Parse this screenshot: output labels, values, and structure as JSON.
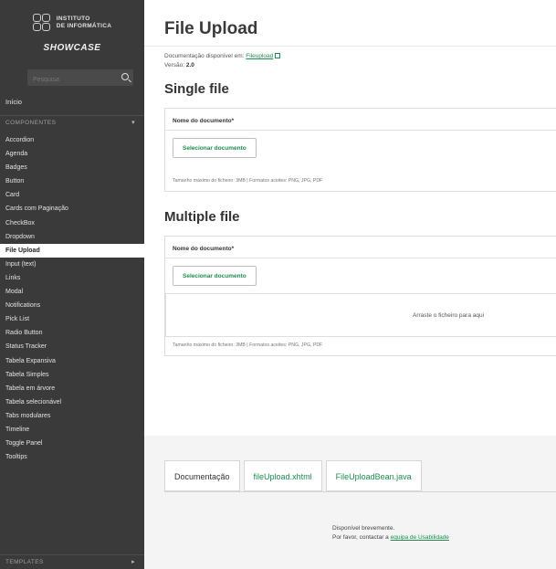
{
  "sidebar": {
    "logo_line1": "INSTITUTO",
    "logo_line2": "DE INFORMÁTICA",
    "showcase": "SHOWCASE",
    "search_placeholder": "Pesquisa",
    "inicio": "Início",
    "components_header": "COMPONENTES",
    "items": [
      "Accordion",
      "Agenda",
      "Badges",
      "Button",
      "Card",
      "Cards com Paginação",
      "CheckBox",
      "Dropdown",
      "File Upload",
      "Input (text)",
      "Links",
      "Modal",
      "Notifications",
      "Pick List",
      "Radio Button",
      "Status Tracker",
      "Tabela Expansiva",
      "Tabela Simples",
      "Tabela em árvore",
      "Tabela selecionável",
      "Tabs modulares",
      "Timeline",
      "Toggle Panel",
      "Tooltips"
    ],
    "active_index": 8,
    "templates_header": "TEMPLATES"
  },
  "main": {
    "title": "File Upload",
    "doc_prefix": "Documentação disponível em: ",
    "doc_link": "Fileupload",
    "version_label": "Versão: ",
    "version_value": "2.0",
    "single": {
      "heading": "Single file",
      "field_label": "Nome do documento*",
      "button": "Selecionar documento",
      "hint": "Tamanho máximo do ficheiro: 3MB | Formatos aceites: PNG, JPG, PDF"
    },
    "multiple": {
      "heading": "Multiple file",
      "field_label": "Nome do documento*",
      "button": "Selecionar documento",
      "drop_text": "Arraste o ficheiro para aqui",
      "hint": "Tamanho máximo do ficheiro: 3MB | Formatos aceites: PNG, JPG, PDF"
    },
    "tabs": [
      "Documentação",
      "fileUpload.xhtml",
      "FileUploadBean.java"
    ],
    "notice_line1": "Disponível brevemente.",
    "notice_line2_prefix": "Por favor, contactar a ",
    "notice_link": "equipa de Usabilidade"
  },
  "colors": {
    "sidebar_bg": "#3a3a3a",
    "accent_green": "#1d8c4e"
  }
}
